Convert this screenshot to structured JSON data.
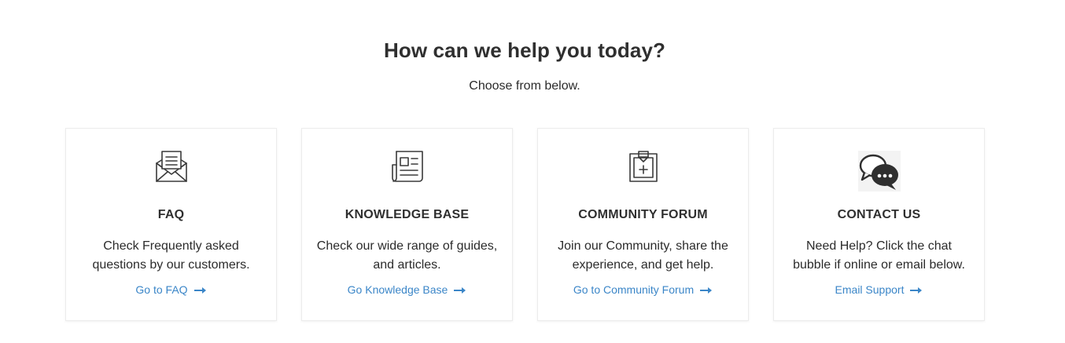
{
  "hero": {
    "title": "How can we help you today?",
    "subtitle": "Choose from below."
  },
  "colors": {
    "link": "#3b86c8",
    "icon": "#3a3a3a",
    "title": "#2f2f2f"
  },
  "cards": [
    {
      "icon": "envelope-letter-icon",
      "title": "FAQ",
      "description": "Check Frequently asked questions by our customers.",
      "link_label": "Go to FAQ"
    },
    {
      "icon": "newspaper-icon",
      "title": "KNOWLEDGE BASE",
      "description": "Check our wide range of guides, and articles.",
      "link_label": "Go Knowledge Base"
    },
    {
      "icon": "clipboard-plus-icon",
      "title": "COMMUNITY FORUM",
      "description": "Join our Community, share the experience, and get help.",
      "link_label": "Go to Community Forum"
    },
    {
      "icon": "chat-bubbles-icon",
      "title": "CONTACT US",
      "description": "Need Help? Click the chat bubble if online or email below.",
      "link_label": "Email Support"
    }
  ]
}
